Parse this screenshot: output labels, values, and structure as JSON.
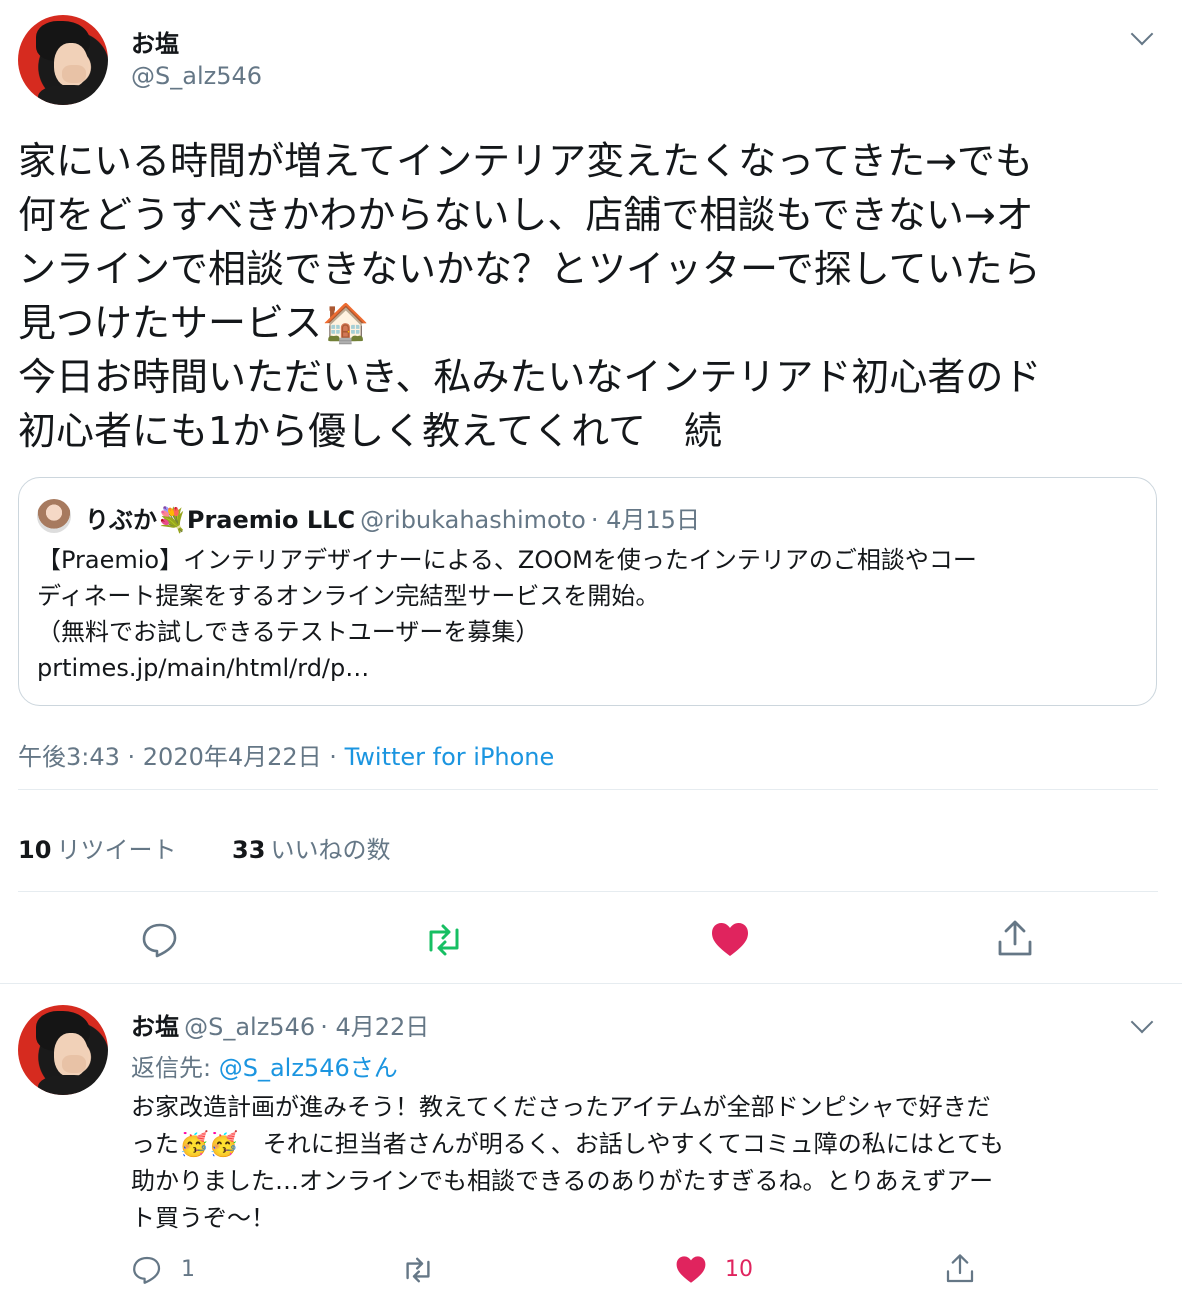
{
  "main_tweet": {
    "author_name": "お塩",
    "author_handle": "@S_alz546",
    "text": "家にいる時間が増えてインテリア変えたくなってきた→でも\n何をどうすべきかわからないし、店舗で相談もできない→オ\nンラインで相談できないかな？とツイッターで探していたら\n見つけたサービス🏠\n今日お時間いただいき、私みたいなインテリアド初心者のド\n初心者にも1から優しく教えてくれて　続",
    "quoted": {
      "author_name": "りぶか💐Praemio LLC",
      "author_handle": "@ribukahashimoto",
      "date": "· 4月15日",
      "text": "【Praemio】インテリアデザイナーによる、ZOOMを使ったインテリアのご相談やコー\nディネート提案をするオンライン完結型サービスを開始。\n（無料でお試しできるテストユーザーを募集）\nprtimes.jp/main/html/rd/p…"
    },
    "timestamp": "午後3:43 · 2020年4月22日 ·",
    "source": "Twitter for iPhone",
    "retweets": "10",
    "retweets_label": "リツイート",
    "likes": "33",
    "likes_label": "いいねの数",
    "icons": {
      "reply": "reply-icon",
      "retweet": "retweet-icon",
      "like": "heart-icon",
      "share": "share-icon"
    },
    "colors": {
      "retweet": "#17bf63",
      "like": "#e0245e",
      "link": "#1b95e0"
    }
  },
  "reply_tweet": {
    "author_name": "お塩",
    "author_handle": "@S_alz546",
    "date": "· 4月22日",
    "reply_to_prefix": "返信先: ",
    "reply_to_handle": "@S_alz546",
    "reply_to_suffix": "さん",
    "text": "お家改造計画が進みそう！教えてくださったアイテムが全部ドンピシャで好きだ\nった🥳🥳　それに担当者さんが明るく、お話しやすくてコミュ障の私にはとても\n助かりました…オンラインでも相談できるのありがたすぎるね。とりあえずアー\nト買うぞ〜！",
    "reply_count": "1",
    "like_count": "10"
  }
}
